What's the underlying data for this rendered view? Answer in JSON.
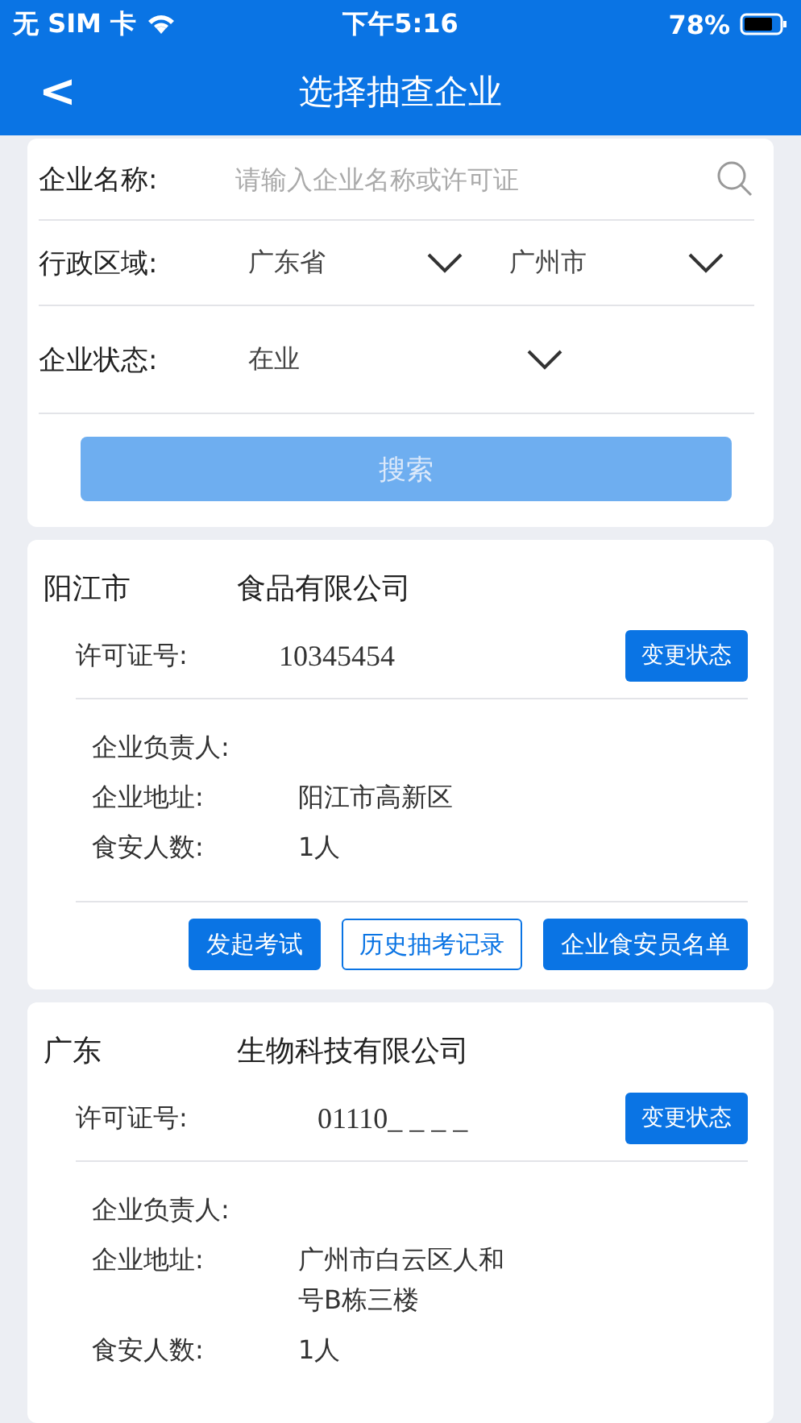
{
  "status_bar": {
    "carrier": "无 SIM 卡",
    "time": "下午5:16",
    "battery": "78%"
  },
  "nav": {
    "back": "<",
    "title": "选择抽查企业"
  },
  "search": {
    "name_label": "企业名称:",
    "name_placeholder": "请输入企业名称或许可证",
    "region_label": "行政区域:",
    "province": "广东省",
    "city": "广州市",
    "status_label": "企业状态:",
    "status": "在业",
    "button": "搜索",
    "button_disabled": true
  },
  "companies": [
    {
      "region": "阳江市",
      "name": "食品有限公司",
      "license_label": "许可证号:",
      "license": "10345454",
      "change_button": "变更状态",
      "fields": [
        {
          "label": "企业负责人:"
        },
        {
          "label": "企业地址:",
          "lines": [
            "阳江市高新区"
          ]
        },
        {
          "label": "食安人数:",
          "lines": [
            "1人"
          ]
        }
      ],
      "actions": [
        {
          "label": "发起考试",
          "kind": "filled"
        },
        {
          "label": "历史抽考记录",
          "kind": "outline"
        },
        {
          "label": "企业食安员名单",
          "kind": "filled"
        }
      ]
    },
    {
      "region": "广东",
      "name": "生物科技有限公司",
      "license_label": "许可证号:",
      "license": "01110_ _ _ _",
      "change_button": "变更状态",
      "fields": [
        {
          "label": "企业负责人:"
        },
        {
          "label": "企业地址:",
          "lines": [
            "广州市白云区人和",
            "号B栋三楼"
          ]
        },
        {
          "label": "食安人数:",
          "lines": [
            "1人"
          ]
        }
      ]
    }
  ]
}
